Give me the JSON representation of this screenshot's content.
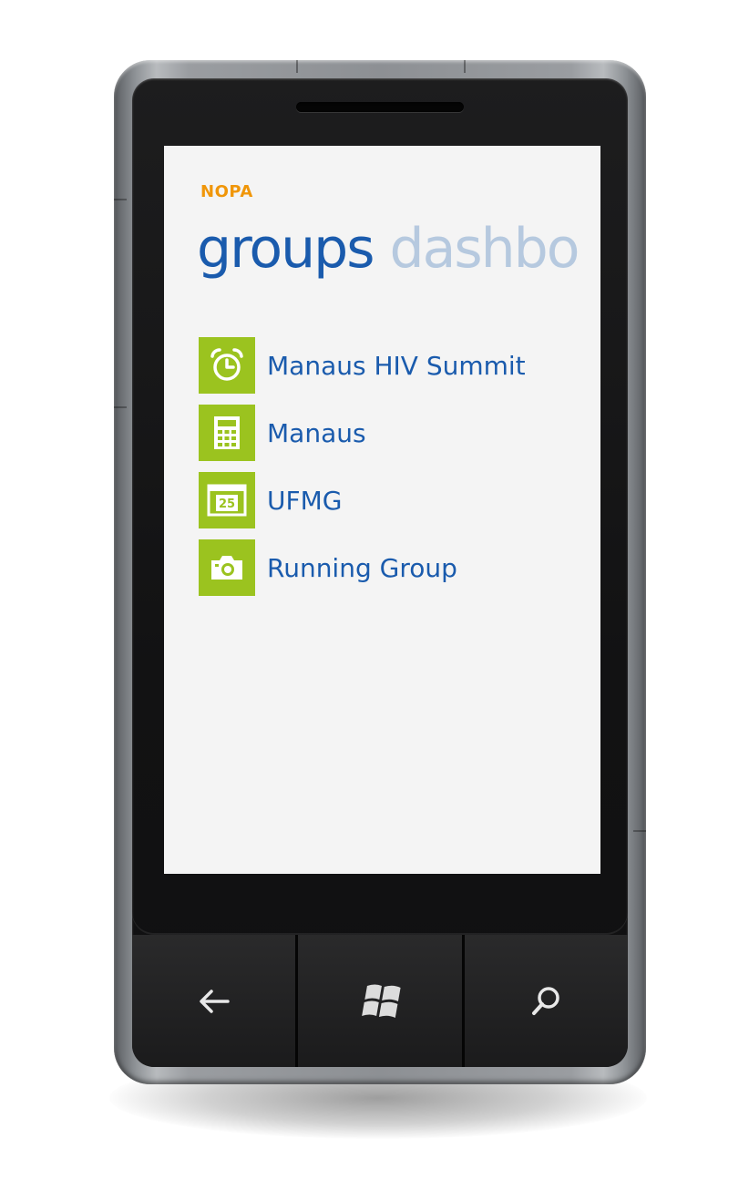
{
  "app": {
    "title": "NOPA"
  },
  "pivot": {
    "active": "groups",
    "next": "dashbo"
  },
  "groups": [
    {
      "label": "Manaus HIV Summit",
      "icon": "alarm-clock-icon"
    },
    {
      "label": "Manaus",
      "icon": "calculator-icon"
    },
    {
      "label": "UFMG",
      "icon": "calendar-icon",
      "calendar_day": "25"
    },
    {
      "label": "Running Group",
      "icon": "camera-icon"
    }
  ],
  "hardware_buttons": [
    {
      "name": "back",
      "icon": "back-arrow-icon"
    },
    {
      "name": "start",
      "icon": "windows-logo-icon"
    },
    {
      "name": "search",
      "icon": "search-icon"
    }
  ],
  "colors": {
    "accent": "#f09609",
    "link": "#1a5bad",
    "tile": "#9bc31f",
    "screen_bg": "#f4f4f4"
  }
}
